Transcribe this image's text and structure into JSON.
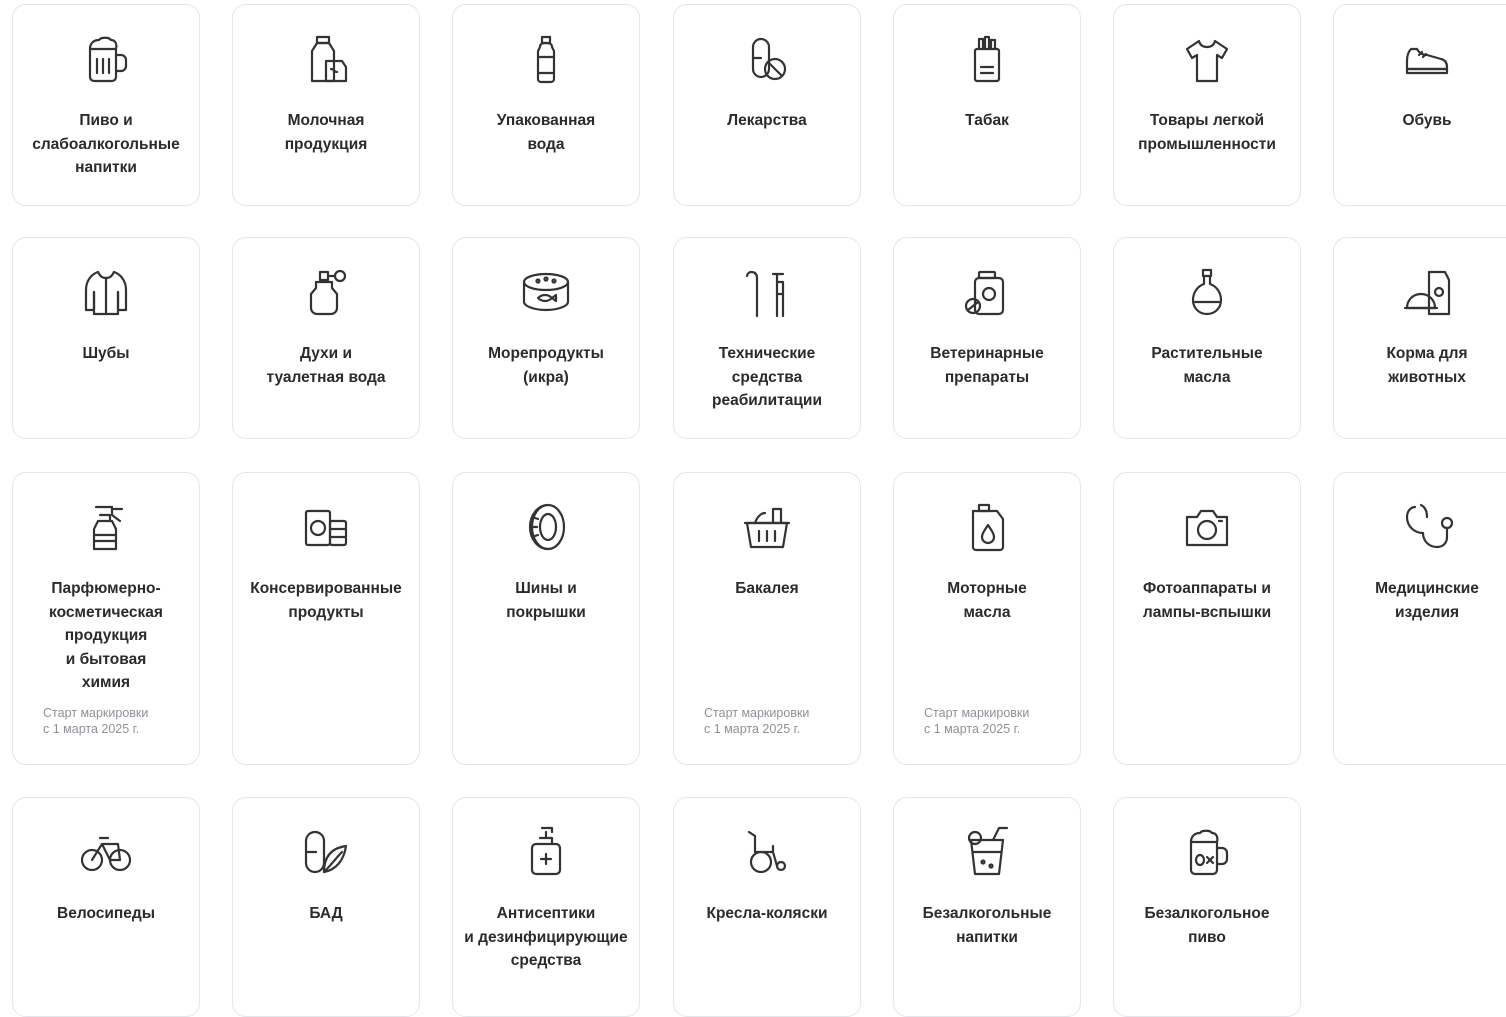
{
  "note_text": "Старт маркировки\nс 1 марта 2025 г.",
  "categories": [
    {
      "id": "beer",
      "icon": "beer-mug-icon",
      "title": "Пиво и\nслабоалкогольные\nнапитки"
    },
    {
      "id": "dairy",
      "icon": "milk-carton-icon",
      "title": "Молочная\nпродукция"
    },
    {
      "id": "water",
      "icon": "water-bottle-icon",
      "title": "Упакованная\nвода"
    },
    {
      "id": "medicine",
      "icon": "pills-icon",
      "title": "Лекарства"
    },
    {
      "id": "tobacco",
      "icon": "cigarette-pack-icon",
      "title": "Табак"
    },
    {
      "id": "clothes",
      "icon": "tshirt-icon",
      "title": "Товары легкой\nпромышленности"
    },
    {
      "id": "shoes",
      "icon": "sneaker-icon",
      "title": "Обувь"
    },
    {
      "id": "furs",
      "icon": "fur-coat-icon",
      "title": "Шубы"
    },
    {
      "id": "perfume",
      "icon": "perfume-bottle-icon",
      "title": "Духи и\nтуалетная вода"
    },
    {
      "id": "seafood",
      "icon": "caviar-can-icon",
      "title": "Морепродукты\n(икра)"
    },
    {
      "id": "rehab",
      "icon": "crutch-icon",
      "title": "Технические\nсредства\nреабилитации"
    },
    {
      "id": "vet",
      "icon": "vet-medicine-jar-icon",
      "title": "Ветеринарные\nпрепараты"
    },
    {
      "id": "oils",
      "icon": "oil-bottle-icon",
      "title": "Растительные\nмасла"
    },
    {
      "id": "petfood",
      "icon": "pet-food-icon",
      "title": "Корма для\nживотных"
    },
    {
      "id": "cosmetics",
      "icon": "spray-bottle-icon",
      "title": "Парфюмерно-\nкосметическая\nпродукция\nи бытовая\nхимия",
      "note": true
    },
    {
      "id": "canned",
      "icon": "canned-goods-icon",
      "title": "Консервированные\nпродукты"
    },
    {
      "id": "tires",
      "icon": "tire-icon",
      "title": "Шины и\nпокрышки"
    },
    {
      "id": "grocery",
      "icon": "grocery-basket-icon",
      "title": "Бакалея",
      "note": true
    },
    {
      "id": "motoroil",
      "icon": "motor-oil-canister-icon",
      "title": "Моторные\nмасла",
      "note": true
    },
    {
      "id": "cameras",
      "icon": "camera-icon",
      "title": "Фотоаппараты и\nлампы-вспышки"
    },
    {
      "id": "medical",
      "icon": "stethoscope-icon",
      "title": "Медицинские\nизделия"
    },
    {
      "id": "bikes",
      "icon": "bicycle-icon",
      "title": "Велосипеды"
    },
    {
      "id": "supplements",
      "icon": "supplement-leaf-icon",
      "title": "БАД"
    },
    {
      "id": "antiseptics",
      "icon": "dispenser-bottle-icon",
      "title": "Антисептики\nи дезинфицирующие\nсредства"
    },
    {
      "id": "wheelchairs",
      "icon": "wheelchair-icon",
      "title": "Кресла-коляски"
    },
    {
      "id": "softdrinks",
      "icon": "cocktail-glass-icon",
      "title": "Безалкогольные\nнапитки"
    },
    {
      "id": "nabeer",
      "icon": "beer-zero-icon",
      "title": "Безалкогольное\nпиво"
    }
  ]
}
